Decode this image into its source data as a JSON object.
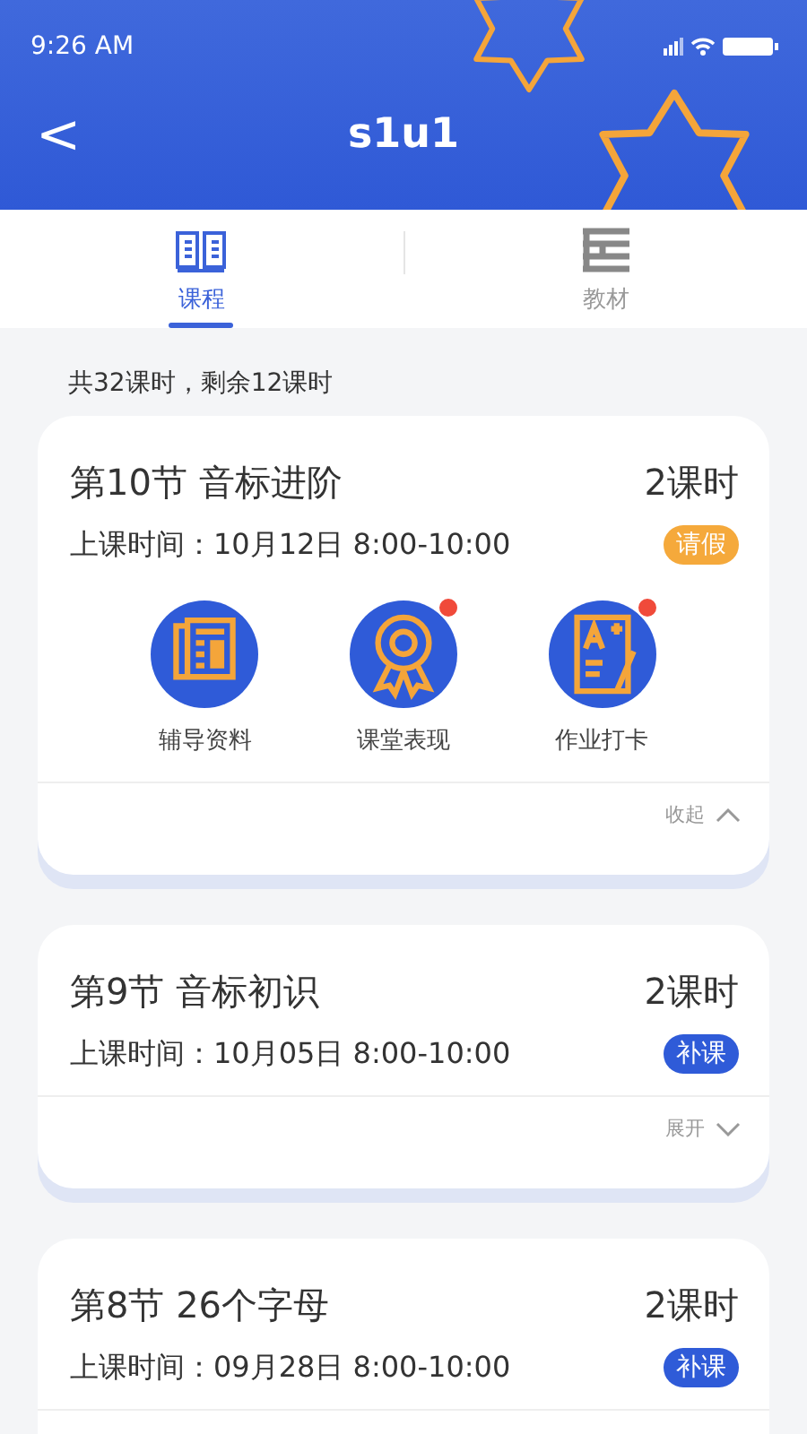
{
  "status_bar": {
    "time": "9:26 AM"
  },
  "header": {
    "back": "<",
    "title": "s1u1"
  },
  "tabs": [
    {
      "label": "课程",
      "kind": "book",
      "selected": true
    },
    {
      "label": "教材",
      "kind": "textbook",
      "selected": false
    }
  ],
  "summary": "共32课时，剩余12课时",
  "lessons": [
    {
      "title": "第10节 音标进阶",
      "hours": "2课时",
      "time": "上课时间：10月12日 8:00-10:00",
      "badge": {
        "label": "请假",
        "color": "#f5a93b"
      },
      "expanded": true,
      "actions": [
        {
          "label": "辅导资料",
          "kind": "document",
          "notification": false
        },
        {
          "label": "课堂表现",
          "kind": "medal",
          "notification": true
        },
        {
          "label": "作业打卡",
          "kind": "homework",
          "notification": true
        }
      ],
      "toggle_label": "收起"
    },
    {
      "title": "第9节 音标初识",
      "hours": "2课时",
      "time": "上课时间：10月05日 8:00-10:00",
      "badge": {
        "label": "补课",
        "color": "#2f5bd8"
      },
      "expanded": false,
      "toggle_label": "展开"
    },
    {
      "title": "第8节 26个字母",
      "hours": "2课时",
      "time": "上课时间：09月28日 8:00-10:00",
      "badge": {
        "label": "补课",
        "color": "#2f5bd8"
      },
      "expanded": false
    }
  ]
}
